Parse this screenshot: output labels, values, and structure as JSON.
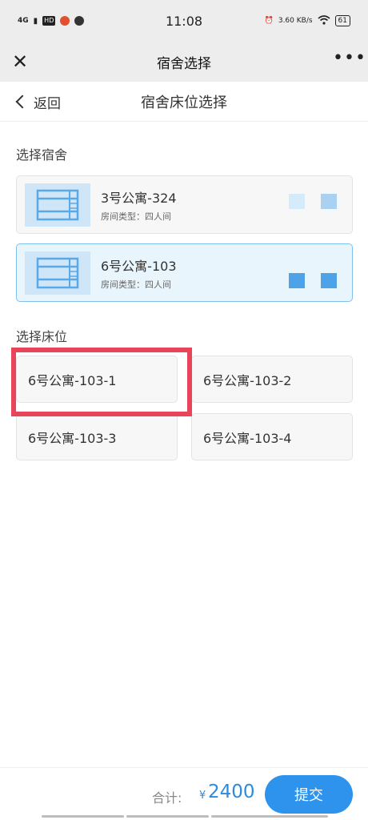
{
  "status_bar": {
    "signal": "4G",
    "hd_badge": "HD",
    "time": "11:08",
    "net_speed": "3.60 KB/s",
    "battery": "61"
  },
  "wx_header": {
    "title": "宿舍选择"
  },
  "page_header": {
    "back_label": "返回",
    "title": "宿舍床位选择"
  },
  "dorm_section": {
    "label": "选择宿舍",
    "items": [
      {
        "name": "3号公寓-324",
        "type": "房间类型：四人间",
        "selected": false
      },
      {
        "name": "6号公寓-103",
        "type": "房间类型：四人间",
        "selected": true
      }
    ]
  },
  "bed_section": {
    "label": "选择床位",
    "items": [
      {
        "label": "6号公寓-103-1"
      },
      {
        "label": "6号公寓-103-2"
      },
      {
        "label": "6号公寓-103-3"
      },
      {
        "label": "6号公寓-103-4"
      }
    ]
  },
  "bottom_bar": {
    "total_label": "合计:",
    "currency": "¥",
    "amount": "2400",
    "submit_label": "提交"
  },
  "colors": {
    "accent": "#2d93ec",
    "highlight": "#e8455a",
    "selected_bg": "#e9f5fd",
    "icon_blue": "#5aa9e6"
  }
}
